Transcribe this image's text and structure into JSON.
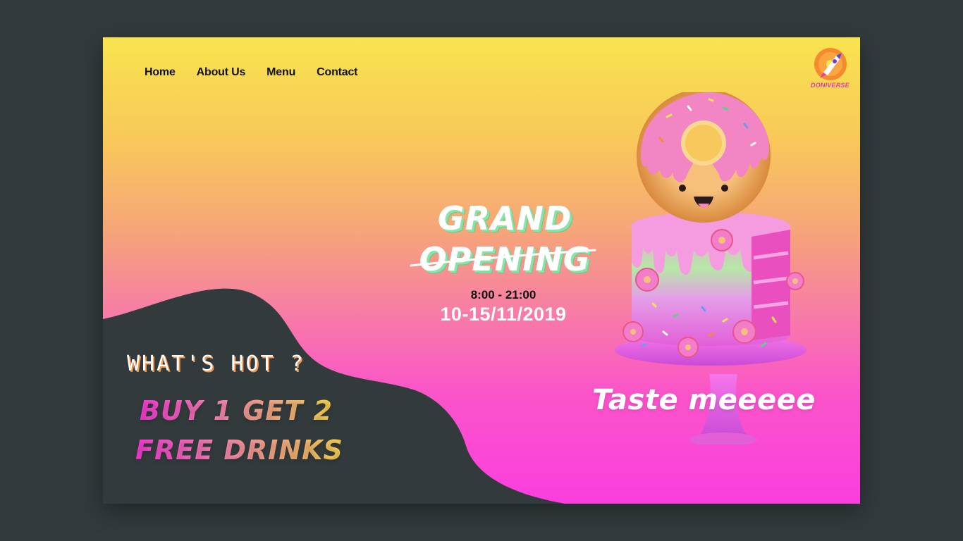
{
  "nav": {
    "items": [
      {
        "label": "Home"
      },
      {
        "label": "About Us"
      },
      {
        "label": "Menu"
      },
      {
        "label": "Contact"
      }
    ]
  },
  "brand": {
    "name": "DONIVERSE",
    "icon": "rocket-donut-icon"
  },
  "hero": {
    "title_line1": "GRAND",
    "title_line2": "OPENING",
    "hours": "8:00 - 21:00",
    "dates": "10-15/11/2019",
    "tagline": "Taste meeeee",
    "image": "donut-cake-illustration"
  },
  "promo": {
    "heading": "WHAT'S HOT ?",
    "line1": "BUY 1 GET 2",
    "line2": "FREE DRINKS"
  },
  "colors": {
    "page_bg": "#323a3b",
    "gradient_top": "#f8e44e",
    "gradient_bottom": "#fb3ee0",
    "blob": "#323a3b",
    "title_shadow": "#8fe0a8"
  }
}
